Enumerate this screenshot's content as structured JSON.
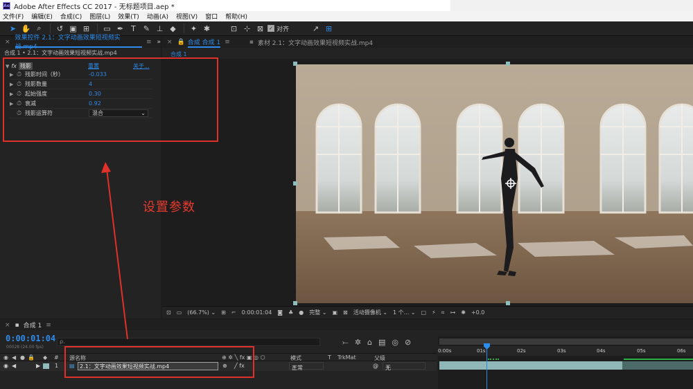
{
  "titlebar": {
    "logo": "Ae",
    "title": "Adobe After Effects CC 2017 - 无标题项目.aep *"
  },
  "menu": [
    "文件(F)",
    "编辑(E)",
    "合成(C)",
    "图层(L)",
    "效果(T)",
    "动画(A)",
    "视图(V)",
    "窗口",
    "帮助(H)"
  ],
  "toolbar": {
    "tools": [
      "selection-tool",
      "hand-tool",
      "zoom-tool",
      "rotate-tool",
      "camera-tool",
      "pan-behind-tool",
      "rectangle-tool",
      "pen-tool",
      "type-tool",
      "brush-tool",
      "clone-stamp-tool",
      "eraser-tool",
      "roto-brush-tool",
      "puppet-pin-tool"
    ],
    "snap_label": "对齐"
  },
  "effects_panel": {
    "tab_label": "效果控件 2.1：文字动画效果短视频实战.mp4",
    "subtitle": "合成 1 • 2.1：文字动画效果短视频实战.mp4",
    "effect": {
      "glyph": "fx",
      "name": "残影",
      "reset": "重置",
      "about": "关于..."
    },
    "properties": [
      {
        "name": "残影时间（秒）",
        "value": "-0.033",
        "expandable": true
      },
      {
        "name": "残影数量",
        "value": "4",
        "expandable": true
      },
      {
        "name": "起始强度",
        "value": "0.30",
        "expandable": true
      },
      {
        "name": "衰减",
        "value": "0.92",
        "expandable": true
      },
      {
        "name": "残影运算符",
        "value": "混合",
        "expandable": false,
        "dropdown": true
      }
    ]
  },
  "comp_panel": {
    "tab_label": "合成 合成 1",
    "footage_tab": "素材 2.1：文字动画效果短视频实战.mp4",
    "subtab": "合成 1",
    "bottombar": {
      "zoom": "(66.7%)",
      "timecode": "0:00:01:04",
      "resolution": "完整",
      "camera": "活动摄像机",
      "views": "1 个...",
      "exposure": "+0.0"
    }
  },
  "timeline": {
    "tab_label": "合成 1",
    "timecode": "0:00:01:04",
    "fps": "00028 (24.00 fps)",
    "search_placeholder": "ρ.",
    "columns": {
      "num": "#",
      "source": "源名称",
      "mode": "模式",
      "t": "T",
      "trkmat": "TrkMat",
      "parent": "父级"
    },
    "layer": {
      "index": "1",
      "name": "2.1：文字动画效果短视频实战.mp4",
      "mode": "正常",
      "parent": "无"
    },
    "ruler": [
      "0:00s",
      "01s",
      "02s",
      "03s",
      "04s",
      "05s",
      "06s"
    ],
    "playhead_seconds": 1.17
  },
  "annotation": {
    "text": "设置参数",
    "color": "#e43b2f"
  },
  "colors": {
    "accent": "#2d8ceb",
    "panel": "#232323",
    "annotation_red": "#e0302a"
  }
}
